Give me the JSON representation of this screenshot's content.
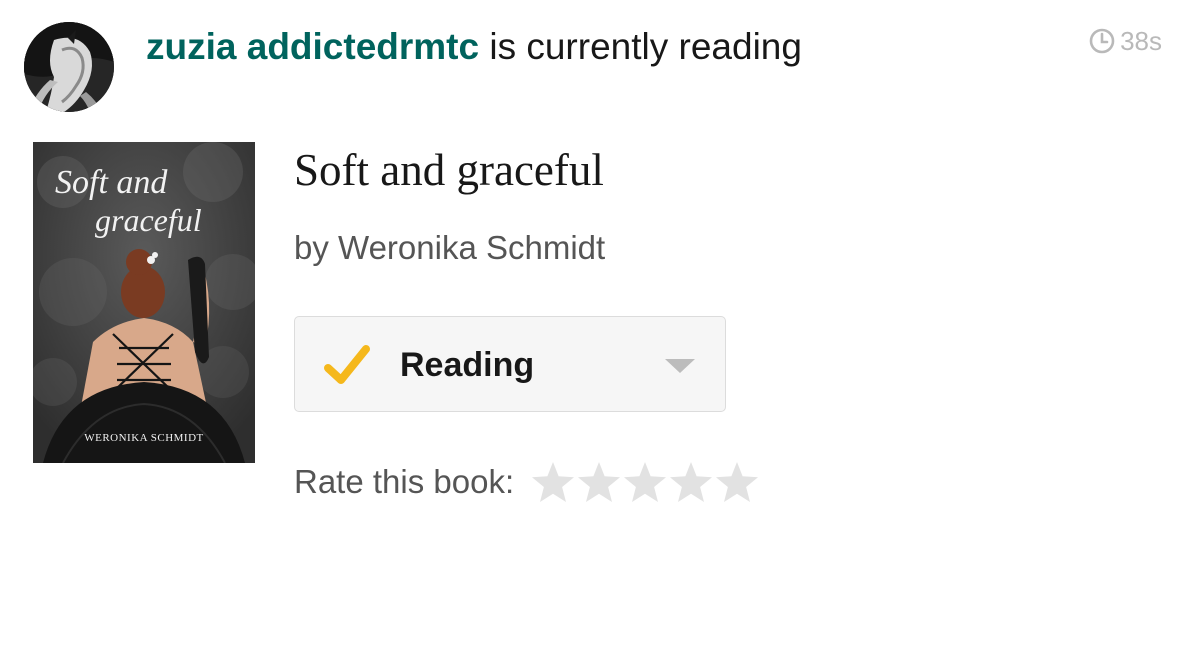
{
  "activity": {
    "user_name": "zuzia addictedrmtc",
    "action_text": "is currently reading",
    "timestamp": "38s"
  },
  "book": {
    "title": "Soft and graceful",
    "author_line": "by Weronika Schmidt",
    "cover": {
      "title_line_1": "Soft and",
      "title_line_2": "graceful",
      "author": "WERONIKA SCHMIDT"
    }
  },
  "shelf": {
    "status_label": "Reading",
    "check_color": "#f5b81c"
  },
  "rating": {
    "label": "Rate this book:",
    "max_stars": 5,
    "current": 0,
    "star_color": "#e2e2e2"
  },
  "colors": {
    "username": "#00635d",
    "text": "#181818",
    "muted_text": "#555555",
    "timestamp": "#b9b9b9"
  },
  "icons": {
    "timestamp": "clock-icon",
    "shelf_status": "checkmark-icon",
    "shelf_menu": "caret-down-icon",
    "rating": "star-icon"
  }
}
